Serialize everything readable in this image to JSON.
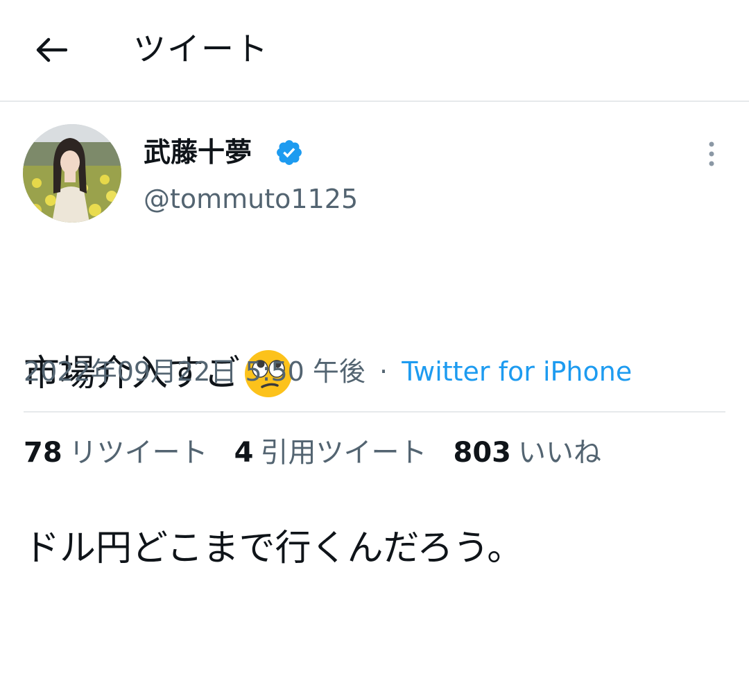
{
  "header": {
    "title": "ツイート",
    "back_icon": "arrow-left-icon"
  },
  "author": {
    "name": "武藤十夢",
    "handle": "@tommuto1125",
    "verified_icon": "verified-badge-icon",
    "verified_color": "#1d9bf0",
    "more_icon": "more-vertical-icon"
  },
  "tweet": {
    "line1": "市場介入すご",
    "line1_emoji": "face-with-rolling-eyes-icon",
    "line2": "ドル円どこまで行くんだろう。",
    "date": "2022年09月22日 5:50 午後",
    "separator": "·",
    "source": "Twitter for iPhone"
  },
  "stats": {
    "retweets": {
      "count": "78",
      "label": "リツイート"
    },
    "quotes": {
      "count": "4",
      "label": "引用ツイート"
    },
    "likes": {
      "count": "803",
      "label": "いいね"
    }
  },
  "colors": {
    "accent": "#1d9bf0",
    "secondary_text": "#536471",
    "divider": "#e6e9eb"
  }
}
